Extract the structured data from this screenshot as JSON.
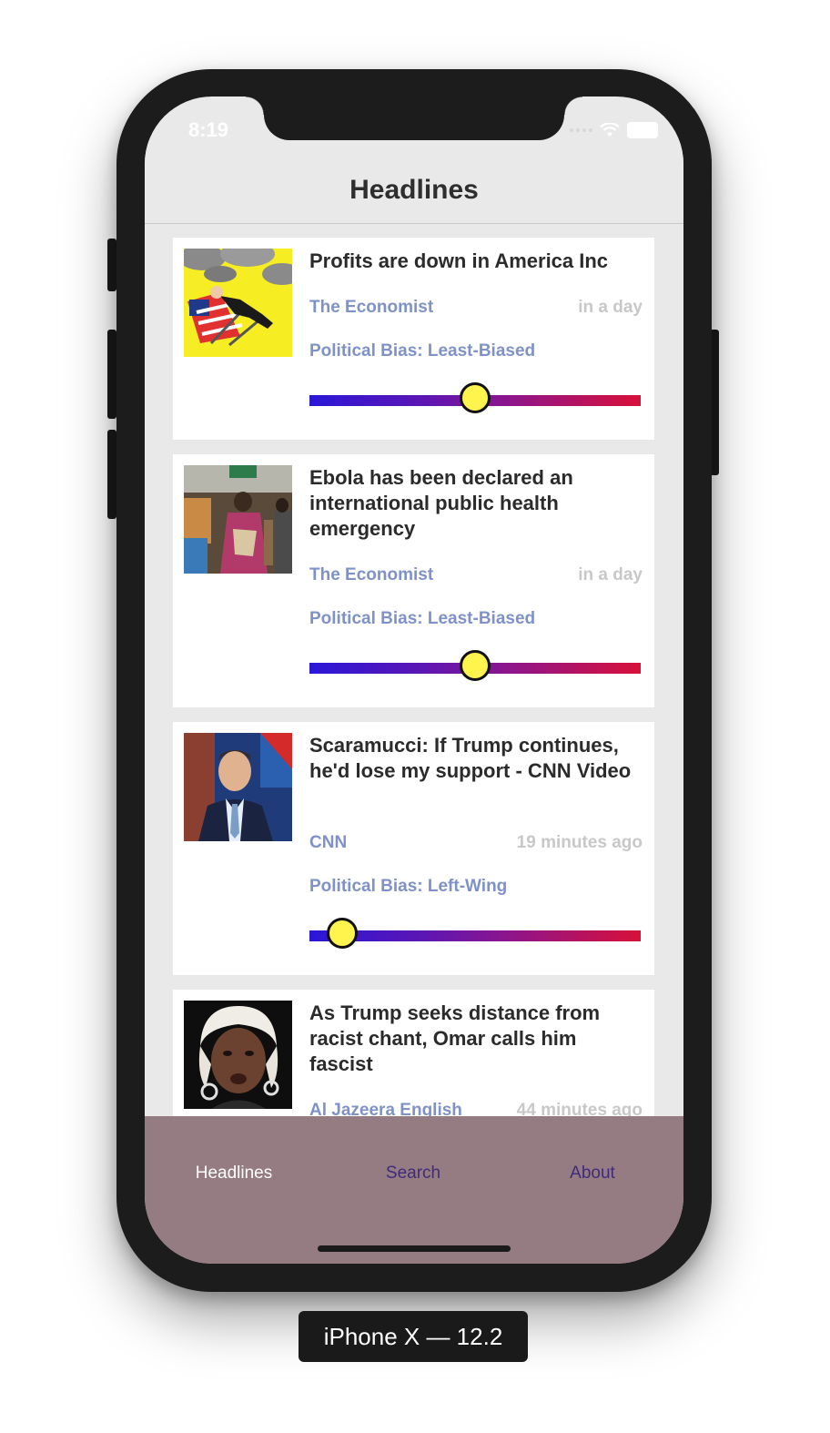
{
  "status": {
    "time": "8:19"
  },
  "nav": {
    "title": "Headlines"
  },
  "articles": [
    {
      "title": "Profits are down in America Inc",
      "source": "The Economist",
      "time": "in a day",
      "bias_label": "Political Bias: Least-Biased",
      "bias_level": 0.5,
      "thumb": "chair-illustration"
    },
    {
      "title": "Ebola has been declared an international public health emergency",
      "source": "The Economist",
      "time": "in a day",
      "bias_label": "Political Bias: Least-Biased",
      "bias_level": 0.5,
      "thumb": "crowd-photo"
    },
    {
      "title": "Scaramucci: If Trump continues, he'd lose my support - CNN Video",
      "source": "CNN",
      "time": "19 minutes ago",
      "bias_label": "Political Bias: Left-Wing",
      "bias_level": 0.1,
      "thumb": "man-portrait"
    },
    {
      "title": "As Trump seeks distance from racist chant, Omar calls him fascist",
      "source": "Al Jazeera English",
      "time": "44 minutes ago",
      "bias_label": "",
      "bias_level": null,
      "thumb": "woman-portrait"
    }
  ],
  "tabs": [
    {
      "label": "Headlines",
      "active": true
    },
    {
      "label": "Search",
      "active": false
    },
    {
      "label": "About",
      "active": false
    }
  ],
  "device_label": "iPhone X — 12.2",
  "colors": {
    "source": "#7f92c8",
    "tab_bar": "#957b82",
    "tab_active": "#ffffff",
    "tab_inactive": "#3f2b7c",
    "knob": "#fff34e"
  }
}
